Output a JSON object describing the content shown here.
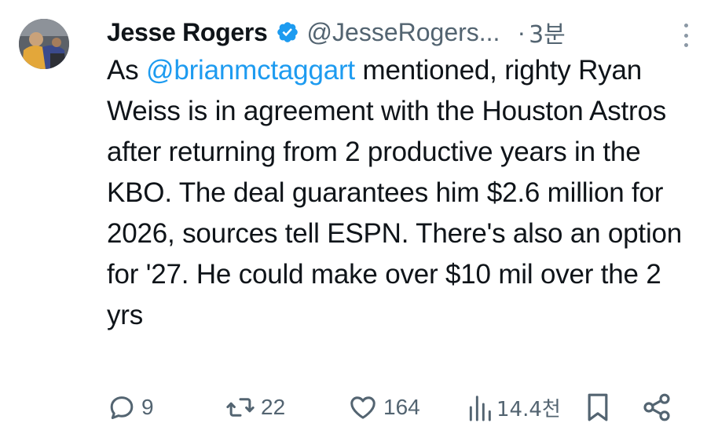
{
  "author": {
    "name": "Jesse Rogers",
    "handle": "@JesseRogers...",
    "time_separator": "·",
    "time": "3분"
  },
  "tweet": {
    "before_mention": "As ",
    "mention": "@brianmctaggart",
    "after_mention": " mentioned, righty Ryan Weiss is in agreement with the Houston Astros after returning from 2 productive years in the KBO. The deal guarantees him $2.6 million for 2026, sources tell ESPN. There's also an option for '27. He could make over $10 mil over the 2 yrs"
  },
  "actions": {
    "replies": "9",
    "reposts": "22",
    "likes": "164",
    "views": "14.4천"
  },
  "colors": {
    "text": "#0f1419",
    "secondary": "#536471",
    "mention": "#1d9bf0",
    "verified": "#1d9bf0"
  },
  "icons": [
    "avatar",
    "verified-badge-icon",
    "more-options-icon",
    "reply-icon",
    "repost-icon",
    "like-icon",
    "views-icon",
    "bookmark-icon",
    "share-icon"
  ]
}
